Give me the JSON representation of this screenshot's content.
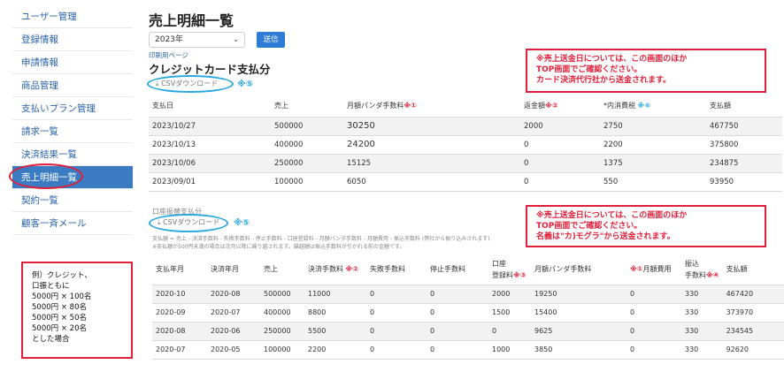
{
  "sidebar": {
    "items": [
      {
        "label": "ユーザー管理"
      },
      {
        "label": "登録情報"
      },
      {
        "label": "申請情報"
      },
      {
        "label": "商品管理"
      },
      {
        "label": "支払いプラン管理"
      },
      {
        "label": "請求一覧"
      },
      {
        "label": "決済結果一覧"
      },
      {
        "label": "売上明細一覧"
      },
      {
        "label": "契約一覧"
      },
      {
        "label": "顧客一斉メール"
      }
    ]
  },
  "page": {
    "title": "売上明細一覧",
    "year_selected": "2023年",
    "send_label": "送信",
    "print_label": "印刷用ページ"
  },
  "credit": {
    "title": "クレジットカード支払分",
    "csv_label": "CSVダウンロード",
    "csv_marker": "※⑤",
    "note": [
      "※売上送金日については、この画面のほか",
      "TOP画面でご確認ください。",
      "カード決済代行社から送金されます。"
    ],
    "headers": [
      "支払日",
      "売上",
      "月額パンダ手数料",
      "※①",
      "返金額",
      "※②",
      "*内消費税",
      "※⑥",
      "支払額"
    ],
    "rows": [
      [
        "2023/10/27",
        "500000",
        "30250",
        "2000",
        "2750",
        "467750"
      ],
      [
        "2023/10/13",
        "400000",
        "24200",
        "0",
        "2200",
        "375800"
      ],
      [
        "2023/10/06",
        "250000",
        "15125",
        "0",
        "1375",
        "234875"
      ],
      [
        "2023/09/01",
        "100000",
        "6050",
        "0",
        "550",
        "93950"
      ]
    ]
  },
  "bank": {
    "title": "口座振替支払分",
    "csv_label": "CSVダウンロード",
    "csv_marker": "※⑤",
    "desc1": "支払額 = 売上 - 決済手数料 - 失敗手数料 - 停止手数料 - 口座登録料 - 月額パンダ手数料 - 月額費用 - 振込手数料 (弊社から振り込みされます)",
    "desc2": "※支払額が500円未満の場合は次月以降に繰り越されます。繰越額は振込手数料が引かれる前の金額です。",
    "note": [
      "※売上送金日については、この画面のほか",
      "TOP画面でご確認ください。",
      "名義は\"カ)モグラ\"から送金されます。"
    ],
    "headers": [
      "支払年月",
      "決済年月",
      "売上",
      "決済手数料",
      "※②",
      "失敗手数料",
      "停止手数料",
      "口座",
      "登録料",
      "※③",
      "月額パンダ手数料",
      "※①",
      "月額費用",
      "振込",
      "手数料",
      "※④",
      "支払額"
    ],
    "rows": [
      [
        "2020-10",
        "2020-08",
        "500000",
        "11000",
        "0",
        "0",
        "2000",
        "19250",
        "0",
        "330",
        "467420"
      ],
      [
        "2020-09",
        "2020-07",
        "400000",
        "8800",
        "0",
        "0",
        "1500",
        "15400",
        "0",
        "330",
        "373970"
      ],
      [
        "2020-08",
        "2020-06",
        "250000",
        "5500",
        "0",
        "0",
        "0",
        "9625",
        "0",
        "330",
        "234545"
      ],
      [
        "2020-07",
        "2020-05",
        "100000",
        "2200",
        "0",
        "0",
        "1000",
        "3850",
        "0",
        "330",
        "92620"
      ]
    ]
  },
  "example": {
    "lines": [
      "例）クレジット、",
      "口振ともに",
      "5000円 × 100名",
      "5000円 × 80名",
      "5000円 × 50名",
      "5000円 × 20名",
      "とした場合"
    ]
  }
}
